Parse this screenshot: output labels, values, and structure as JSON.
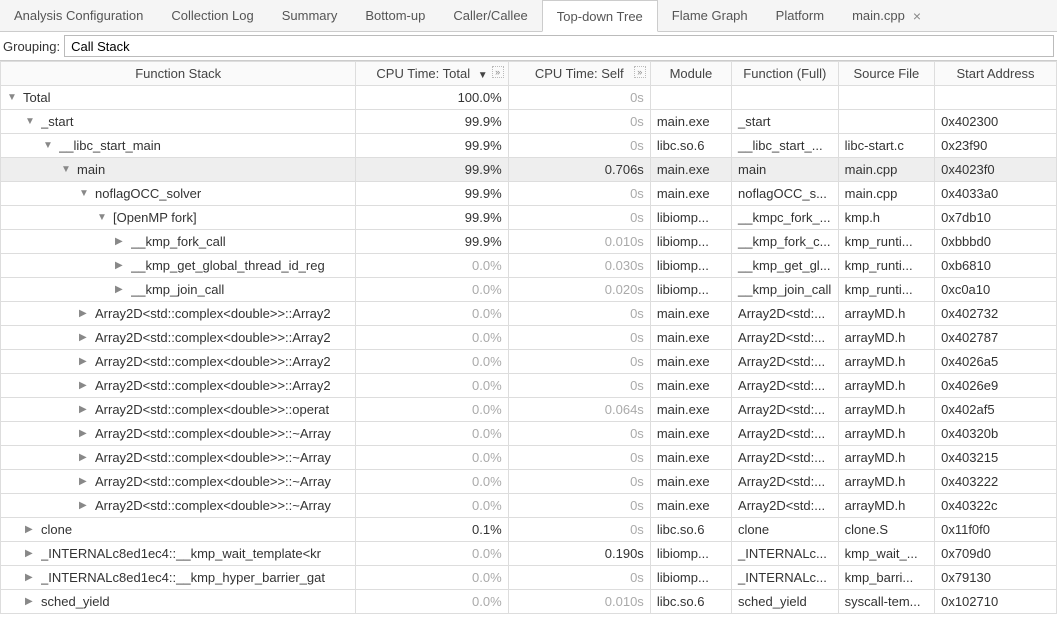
{
  "tabs": [
    {
      "label": "Analysis Configuration"
    },
    {
      "label": "Collection Log"
    },
    {
      "label": "Summary"
    },
    {
      "label": "Bottom-up"
    },
    {
      "label": "Caller/Callee"
    },
    {
      "label": "Top-down Tree",
      "active": true
    },
    {
      "label": "Flame Graph"
    },
    {
      "label": "Platform"
    },
    {
      "label": "main.cpp",
      "closable": true
    }
  ],
  "grouping": {
    "label": "Grouping:",
    "value": "Call Stack"
  },
  "columns": {
    "function_stack": "Function Stack",
    "cpu_total": "CPU Time: Total",
    "cpu_self": "CPU Time: Self",
    "module": "Module",
    "function_full": "Function (Full)",
    "source_file": "Source File",
    "start_address": "Start Address",
    "sort_indicator": "▼"
  },
  "rows": [
    {
      "indent": 0,
      "exp": "open",
      "name": "Total",
      "total": "100.0%",
      "total_gray": false,
      "self": "0s",
      "self_gray": true,
      "mod": "",
      "ff": "",
      "src": "",
      "addr": ""
    },
    {
      "indent": 1,
      "exp": "open",
      "name": "_start",
      "total": "99.9%",
      "total_gray": false,
      "self": "0s",
      "self_gray": true,
      "mod": "main.exe",
      "ff": "_start",
      "src": "",
      "addr": "0x402300"
    },
    {
      "indent": 2,
      "exp": "open",
      "name": "__libc_start_main",
      "total": "99.9%",
      "total_gray": false,
      "self": "0s",
      "self_gray": true,
      "mod": "libc.so.6",
      "ff": "__libc_start_...",
      "src": "libc-start.c",
      "addr": "0x23f90"
    },
    {
      "indent": 3,
      "exp": "open",
      "name": "main",
      "total": "99.9%",
      "total_gray": false,
      "self": "0.706s",
      "self_gray": false,
      "mod": "main.exe",
      "ff": "main",
      "src": "main.cpp",
      "addr": "0x4023f0",
      "sel": true
    },
    {
      "indent": 4,
      "exp": "open",
      "name": "noflagOCC_solver",
      "total": "99.9%",
      "total_gray": false,
      "self": "0s",
      "self_gray": true,
      "mod": "main.exe",
      "ff": "noflagOCC_s...",
      "src": "main.cpp",
      "addr": "0x4033a0"
    },
    {
      "indent": 5,
      "exp": "open",
      "name": "[OpenMP fork]",
      "total": "99.9%",
      "total_gray": false,
      "self": "0s",
      "self_gray": true,
      "mod": "libiomp...",
      "ff": "__kmpc_fork_...",
      "src": "kmp.h",
      "addr": "0x7db10"
    },
    {
      "indent": 6,
      "exp": "closed",
      "name": "__kmp_fork_call",
      "total": "99.9%",
      "total_gray": false,
      "self": "0.010s",
      "self_gray": true,
      "mod": "libiomp...",
      "ff": "__kmp_fork_c...",
      "src": "kmp_runti...",
      "addr": "0xbbbd0"
    },
    {
      "indent": 6,
      "exp": "closed",
      "name": "__kmp_get_global_thread_id_reg",
      "total": "0.0%",
      "total_gray": true,
      "self": "0.030s",
      "self_gray": true,
      "mod": "libiomp...",
      "ff": "__kmp_get_gl...",
      "src": "kmp_runti...",
      "addr": "0xb6810"
    },
    {
      "indent": 6,
      "exp": "closed",
      "name": "__kmp_join_call",
      "total": "0.0%",
      "total_gray": true,
      "self": "0.020s",
      "self_gray": true,
      "mod": "libiomp...",
      "ff": "__kmp_join_call",
      "src": "kmp_runti...",
      "addr": "0xc0a10"
    },
    {
      "indent": 4,
      "exp": "closed",
      "name": "Array2D<std::complex<double>>::Array2",
      "total": "0.0%",
      "total_gray": true,
      "self": "0s",
      "self_gray": true,
      "mod": "main.exe",
      "ff": "Array2D<std:...",
      "src": "arrayMD.h",
      "addr": "0x402732"
    },
    {
      "indent": 4,
      "exp": "closed",
      "name": "Array2D<std::complex<double>>::Array2",
      "total": "0.0%",
      "total_gray": true,
      "self": "0s",
      "self_gray": true,
      "mod": "main.exe",
      "ff": "Array2D<std:...",
      "src": "arrayMD.h",
      "addr": "0x402787"
    },
    {
      "indent": 4,
      "exp": "closed",
      "name": "Array2D<std::complex<double>>::Array2",
      "total": "0.0%",
      "total_gray": true,
      "self": "0s",
      "self_gray": true,
      "mod": "main.exe",
      "ff": "Array2D<std:...",
      "src": "arrayMD.h",
      "addr": "0x4026a5"
    },
    {
      "indent": 4,
      "exp": "closed",
      "name": "Array2D<std::complex<double>>::Array2",
      "total": "0.0%",
      "total_gray": true,
      "self": "0s",
      "self_gray": true,
      "mod": "main.exe",
      "ff": "Array2D<std:...",
      "src": "arrayMD.h",
      "addr": "0x4026e9"
    },
    {
      "indent": 4,
      "exp": "closed",
      "name": "Array2D<std::complex<double>>::operat",
      "total": "0.0%",
      "total_gray": true,
      "self": "0.064s",
      "self_gray": true,
      "mod": "main.exe",
      "ff": "Array2D<std:...",
      "src": "arrayMD.h",
      "addr": "0x402af5"
    },
    {
      "indent": 4,
      "exp": "closed",
      "name": "Array2D<std::complex<double>>::~Array",
      "total": "0.0%",
      "total_gray": true,
      "self": "0s",
      "self_gray": true,
      "mod": "main.exe",
      "ff": "Array2D<std:...",
      "src": "arrayMD.h",
      "addr": "0x40320b"
    },
    {
      "indent": 4,
      "exp": "closed",
      "name": "Array2D<std::complex<double>>::~Array",
      "total": "0.0%",
      "total_gray": true,
      "self": "0s",
      "self_gray": true,
      "mod": "main.exe",
      "ff": "Array2D<std:...",
      "src": "arrayMD.h",
      "addr": "0x403215"
    },
    {
      "indent": 4,
      "exp": "closed",
      "name": "Array2D<std::complex<double>>::~Array",
      "total": "0.0%",
      "total_gray": true,
      "self": "0s",
      "self_gray": true,
      "mod": "main.exe",
      "ff": "Array2D<std:...",
      "src": "arrayMD.h",
      "addr": "0x403222"
    },
    {
      "indent": 4,
      "exp": "closed",
      "name": "Array2D<std::complex<double>>::~Array",
      "total": "0.0%",
      "total_gray": true,
      "self": "0s",
      "self_gray": true,
      "mod": "main.exe",
      "ff": "Array2D<std:...",
      "src": "arrayMD.h",
      "addr": "0x40322c"
    },
    {
      "indent": 1,
      "exp": "closed",
      "name": "clone",
      "total": "0.1%",
      "total_gray": false,
      "self": "0s",
      "self_gray": true,
      "mod": "libc.so.6",
      "ff": "clone",
      "src": "clone.S",
      "addr": "0x11f0f0"
    },
    {
      "indent": 1,
      "exp": "closed",
      "name": "_INTERNALc8ed1ec4::__kmp_wait_template<kr",
      "total": "0.0%",
      "total_gray": true,
      "self": "0.190s",
      "self_gray": false,
      "mod": "libiomp...",
      "ff": "_INTERNALc...",
      "src": "kmp_wait_...",
      "addr": "0x709d0"
    },
    {
      "indent": 1,
      "exp": "closed",
      "name": "_INTERNALc8ed1ec4::__kmp_hyper_barrier_gat",
      "total": "0.0%",
      "total_gray": true,
      "self": "0s",
      "self_gray": true,
      "mod": "libiomp...",
      "ff": "_INTERNALc...",
      "src": "kmp_barri...",
      "addr": "0x79130"
    },
    {
      "indent": 1,
      "exp": "closed",
      "name": "sched_yield",
      "total": "0.0%",
      "total_gray": true,
      "self": "0.010s",
      "self_gray": true,
      "mod": "libc.so.6",
      "ff": "sched_yield",
      "src": "syscall-tem...",
      "addr": "0x102710"
    }
  ]
}
